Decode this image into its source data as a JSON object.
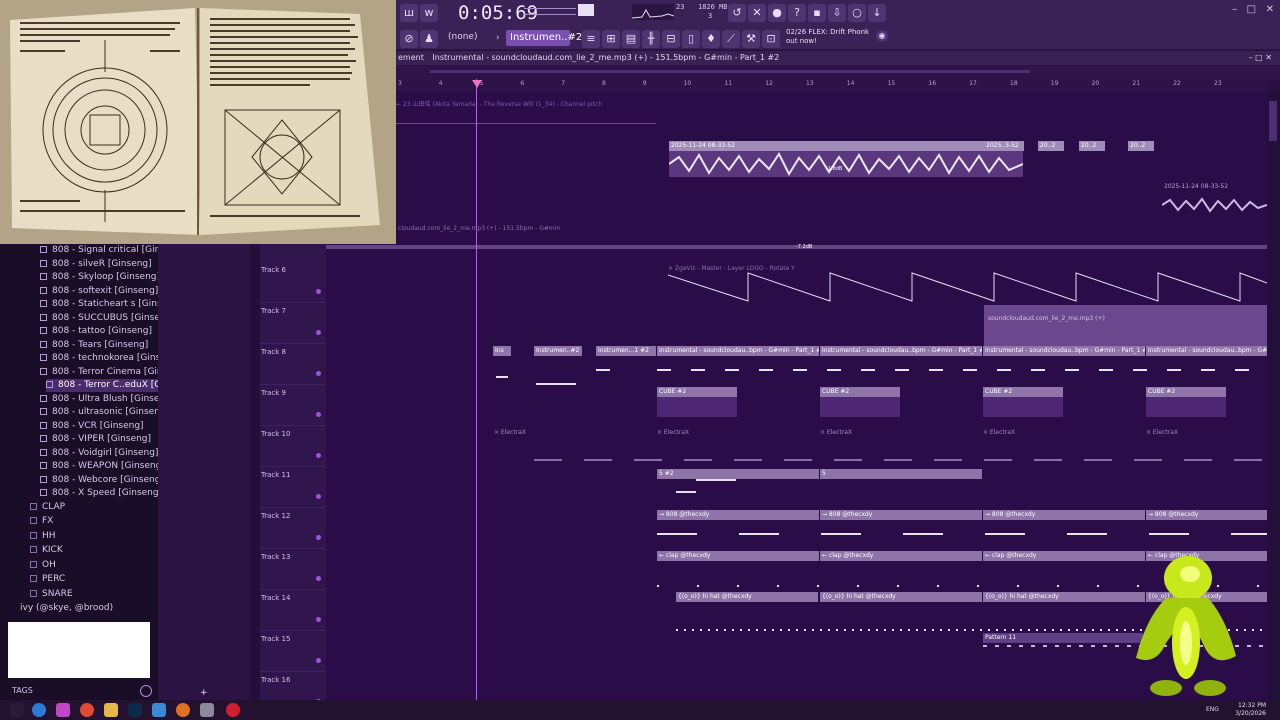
{
  "toolbar": {
    "time": "0:05:69",
    "memory": "1826 MB",
    "cpu": "23",
    "voices": "3",
    "preset_none": "(none)",
    "pattern": "Instrumen..#2",
    "news_line1": "02/26  FLEX: Drift Phonk",
    "news_line2": "out now!"
  },
  "playlist": {
    "title_prefix": "ement",
    "title": "Instrumental - soundcloudaud.com_lie_2_me.mp3 (+) - 151.5bpm - G#min - Part_1 #2",
    "ruler": [
      "3",
      "4",
      "5",
      "6",
      "7",
      "8",
      "9",
      "10",
      "11",
      "12",
      "13",
      "14",
      "15",
      "16",
      "17",
      "18",
      "19",
      "20",
      "21",
      "22",
      "23"
    ],
    "automation_label": "← 23 山田瑶 (Akita Yamada) - The Reverse Will (1_34) - Channel pitch",
    "audio_clip_1": "2025-11-24 08-33-52",
    "audio_clip_2": "2025..3-52",
    "audio_clip_3": "20..2",
    "audio_clip_4": "2025-11-24 08-33-52",
    "audio_main": "cloudaud.com_lie_2_me.mp3 (+) - 151.5bpm - G#min",
    "gain_1": "-1.8dB",
    "gain_2": "-7.2dB",
    "zgeviz": "× ZgeViz - Master - Layer LOGO - Rotate Y",
    "soundcloud_clip": "soundcloudaud.com_lie_2_me.mp3 (+)",
    "instr_clip_a": "Ins",
    "instr_clip_b": "Instrumen..#2",
    "instr_clip_c": "Instrumen...1 #2",
    "instr_clip_d": "Instrumental - soundcloudau..bpm - G#min - Part_1 #2",
    "cube_clip": "CUBE #2",
    "electra_clip": "× ElectraX",
    "five_clip": "5 #2",
    "five_clip_b": "5",
    "kick_clip": "→ 808 @thecxdy",
    "clap_clip": "← clap @thecxdy",
    "hat_clip": "{(o_o)} hi hat @thecxdy",
    "pattern_clip": "Pattern 11"
  },
  "tracks": [
    "Track 6",
    "Track 7",
    "Track 8",
    "Track 9",
    "Track 10",
    "Track 11",
    "Track 12",
    "Track 13",
    "Track 14",
    "Track 15",
    "Track 16"
  ],
  "browser": {
    "items": [
      "808 - Signal critical [Ginseng]",
      "808 - silveR [Ginseng]",
      "808 - Skyloop [Ginseng]",
      "808 - softexit [Ginseng]",
      "808 - Staticheart s [Ginseng]",
      "808 - SUCCUBUS [Ginseng]",
      "808 - tattoo [Ginseng]",
      "808 - Tears [Ginseng]",
      "808 - technokorea [Ginseng]",
      "808 - Terror Cinema [Ginseng]",
      "808 - Terror C..eduX [Ginseng]",
      "808 - Ultra Blush [Ginseng]",
      "808 - ultrasonic [Ginseng]",
      "808 - VCR [Ginseng]",
      "808 - VIPER [Ginseng]",
      "808 - Voidgirl [Ginseng]",
      "808 - WEAPON [Ginseng]",
      "808 - Webcore [Ginseng]",
      "808 - X Speed [Ginseng]"
    ],
    "folders": [
      "CLAP",
      "FX",
      "HH",
      "KICK",
      "OH",
      "PERC",
      "SNARE"
    ],
    "root_folder": "ivy (@skye, @brood)",
    "tags": "TAGS"
  },
  "taskbar": {
    "lang": "ENG",
    "time": "12:32 PM",
    "date": "3/20/2026"
  },
  "colors": {
    "accent": "#7a4fb0",
    "playlist_bg": "#2a0d48",
    "clip": "#8e74a8"
  }
}
